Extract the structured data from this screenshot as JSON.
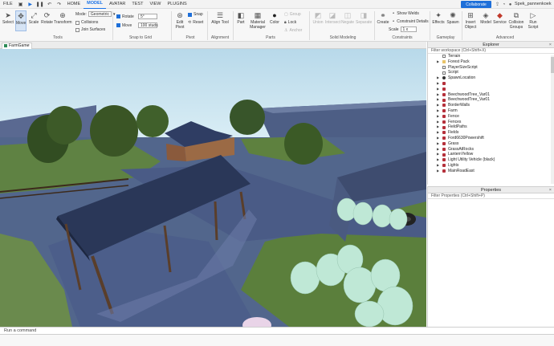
{
  "menu": {
    "file": "FILE",
    "tabs": [
      "HOME",
      "MODEL",
      "AVATAR",
      "TEST",
      "VIEW",
      "PLUGINS"
    ],
    "active_tab": "MODEL"
  },
  "topbar": {
    "collaborate": "Collaborate",
    "username": "Spek_pannenkoek"
  },
  "ribbon": {
    "tools": {
      "select": "Select",
      "move": "Move",
      "scale": "Scale",
      "rotate": "Rotate",
      "transform": "Transform",
      "mode_label": "Mode:",
      "mode_value": "Geometric",
      "collisions": "Collisions",
      "join_surfaces": "Join Surfaces",
      "group_label": "Tools"
    },
    "snap": {
      "rotate": "Rotate",
      "rotate_value": "5°",
      "move": "Move",
      "move_value": "100 studs",
      "group_label": "Snap to Grid"
    },
    "pivot": {
      "edit_pivot": "Edit Pivot",
      "snap": "Snap",
      "reset": "Reset",
      "group_label": "Pivot"
    },
    "alignment": {
      "align_tool": "Align Tool",
      "group_label": "Alignment"
    },
    "parts": {
      "part": "Part",
      "material_manager": "Material Manager",
      "color": "Color",
      "group": "Group",
      "lock": "Lock",
      "anchor": "Anchor",
      "group_label": "Parts"
    },
    "solid_modeling": {
      "union": "Union",
      "intersect": "Intersect",
      "negate": "Negate",
      "separate": "Separate",
      "group_label": "Solid Modeling"
    },
    "constraints": {
      "create": "Create",
      "show_welds": "Show Welds",
      "constraint_details": "Constraint Details",
      "scale_label": "Scale",
      "scale_value": "1 x",
      "group_label": "Constraints"
    },
    "gameplay": {
      "effects": "Effects",
      "spawn": "Spawn",
      "group_label": "Gameplay"
    },
    "advanced": {
      "insert_object": "Insert Object",
      "model": "Model",
      "service": "Service",
      "collision_groups": "Collision Groups",
      "run_script": "Run Script",
      "group_label": "Advanced"
    }
  },
  "doc_tab": {
    "label": "FarmGame"
  },
  "explorer": {
    "title": "Explorer",
    "filter_placeholder": "Filter workspace (Ctrl+Shift+X)",
    "items": [
      {
        "label": "Terrain",
        "icon": "terrain-icon",
        "expand": false
      },
      {
        "label": "Forest Pack",
        "icon": "folder-icon",
        "expand": true
      },
      {
        "label": "PlayerSizeScript",
        "icon": "script-icon",
        "expand": false
      },
      {
        "label": "Script",
        "icon": "script-icon",
        "expand": false
      },
      {
        "label": "SpawnLocation",
        "icon": "spawn-icon",
        "expand": true
      },
      {
        "label": "",
        "icon": "model-icon",
        "expand": true
      },
      {
        "label": "",
        "icon": "model-icon",
        "expand": true
      },
      {
        "label": "BeechwoodTree_Var01",
        "icon": "model-icon",
        "expand": true
      },
      {
        "label": "BeechwoodTree_Var01",
        "icon": "model-icon",
        "expand": true
      },
      {
        "label": "BorderWalls",
        "icon": "model-icon",
        "expand": true
      },
      {
        "label": "Farm",
        "icon": "model-icon",
        "expand": true
      },
      {
        "label": "Fence",
        "icon": "model-icon",
        "expand": true
      },
      {
        "label": "Fences",
        "icon": "model-icon",
        "expand": true
      },
      {
        "label": "FieldPaths",
        "icon": "model-icon",
        "expand": true
      },
      {
        "label": "Fields",
        "icon": "model-icon",
        "expand": true
      },
      {
        "label": "Ford6630Powershift",
        "icon": "model-icon",
        "expand": true
      },
      {
        "label": "Grass",
        "icon": "model-icon",
        "expand": true
      },
      {
        "label": "GrassAtRocks",
        "icon": "model-icon",
        "expand": true
      },
      {
        "label": "LanternYellow",
        "icon": "model-icon",
        "expand": true
      },
      {
        "label": "Light Utility Vehicle (black)",
        "icon": "model-icon",
        "expand": true
      },
      {
        "label": "Lights",
        "icon": "model-icon",
        "expand": true
      },
      {
        "label": "MainRoadEast",
        "icon": "model-icon",
        "expand": true
      }
    ]
  },
  "properties": {
    "title": "Properties",
    "filter_placeholder": "Filter Properties (Ctrl+Shift+P)"
  },
  "command_bar": {
    "placeholder": "Run a command"
  },
  "colors": {
    "accent": "#1e6fd9",
    "sky": "#c9e3ef",
    "road": "#4c5f87",
    "grass": "#5d7f3e",
    "hay_bale": "#bfe8d6"
  }
}
